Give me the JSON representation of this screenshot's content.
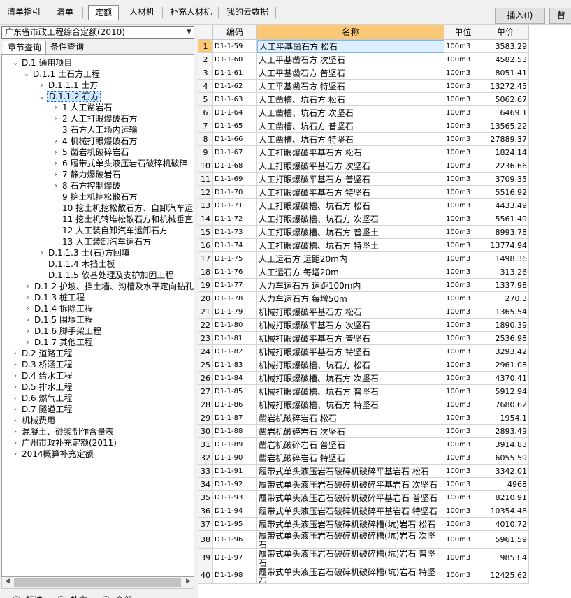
{
  "toolbar": {
    "tabs": [
      "清单指引",
      "清单",
      "定额",
      "人材机",
      "补充人材机",
      "我的云数据"
    ],
    "insert_button": "插入(I)",
    "replace_button": "替"
  },
  "left": {
    "library": "广东省市政工程综合定额(2010)",
    "tabs": [
      "章节查询",
      "条件查询"
    ],
    "tree": [
      "D.1 通用项目",
      "D.1.1 土石方工程",
      "D.1.1.1 土方",
      "D.1.1.2 石方",
      "1 人工凿岩石",
      "2 人工打眼爆破石方",
      "3 石方人工场内运输",
      "4 机械打眼爆破石方",
      "5 凿岩机破碎岩石",
      "6 履带式单头液压岩石破碎机破碎",
      "7 静力爆破岩石",
      "8 石方控制爆破",
      "9 挖土机挖松散石方",
      "10 挖土机挖松散石方、自卸汽车运",
      "11 挖土机转堆松散石方和机械垂直",
      "12 人工装自卸汽车运卸石方",
      "13 人工装卸汽车运石方",
      "D.1.1.3 土(石)方回填",
      "D.1.1.4 木挡土板",
      "D.1.1.5 软基处理及支护加固工程",
      "D.1.2 护坡、挡土墙、沟槽及水平定向钻孔",
      "D.1.3 桩工程",
      "D.1.4  拆除工程",
      "D.1.5 围堰工程",
      "D.1.6 脚手架工程",
      "D.1.7 其他工程",
      "D.2 道路工程",
      "D.3 桥涵工程",
      "D.4 给水工程",
      "D.5 排水工程",
      "D.6 燃气工程",
      "D.7 隧道工程",
      "机械费用",
      "混凝土、砂浆制作含量表",
      "广州市政补充定额(2011)",
      "2014概算补充定额"
    ],
    "radios": [
      "标准",
      "补充",
      "全部"
    ]
  },
  "table": {
    "headers": [
      "编码",
      "名称",
      "单位",
      "单价"
    ],
    "rows": [
      [
        "1",
        "D1-1-59",
        "人工平基凿石方 松石",
        "100m3",
        "3583.29"
      ],
      [
        "2",
        "D1-1-60",
        "人工平基凿石方 次坚石",
        "100m3",
        "4582.53"
      ],
      [
        "3",
        "D1-1-61",
        "人工平基凿石方 普坚石",
        "100m3",
        "8051.41"
      ],
      [
        "4",
        "D1-1-62",
        "人工平基凿石方 特坚石",
        "100m3",
        "13272.45"
      ],
      [
        "5",
        "D1-1-63",
        "人工凿槽、坑石方 松石",
        "100m3",
        "5062.67"
      ],
      [
        "6",
        "D1-1-64",
        "人工凿槽、坑石方 次坚石",
        "100m3",
        "6469.1"
      ],
      [
        "7",
        "D1-1-65",
        "人工凿槽、坑石方 普坚石",
        "100m3",
        "13565.22"
      ],
      [
        "8",
        "D1-1-66",
        "人工凿槽、坑石方 特坚石",
        "100m3",
        "27889.37"
      ],
      [
        "9",
        "D1-1-67",
        "人工打眼爆破平基石方 松石",
        "100m3",
        "1824.14"
      ],
      [
        "10",
        "D1-1-68",
        "人工打眼爆破平基石方 次坚石",
        "100m3",
        "2236.66"
      ],
      [
        "11",
        "D1-1-69",
        "人工打眼爆破平基石方 普坚石",
        "100m3",
        "3709.35"
      ],
      [
        "12",
        "D1-1-70",
        "人工打眼爆破平基石方 特坚石",
        "100m3",
        "5516.92"
      ],
      [
        "13",
        "D1-1-71",
        "人工打眼爆破槽、坑石方 松石",
        "100m3",
        "4433.49"
      ],
      [
        "14",
        "D1-1-72",
        "人工打眼爆破槽、坑石方 次坚石",
        "100m3",
        "5561.49"
      ],
      [
        "15",
        "D1-1-73",
        "人工打眼爆破槽、坑石方 普坚土",
        "100m3",
        "8993.78"
      ],
      [
        "16",
        "D1-1-74",
        "人工打眼爆破槽、坑石方 特坚土",
        "100m3",
        "13774.94"
      ],
      [
        "17",
        "D1-1-75",
        "人工运石方 运距20m内",
        "100m3",
        "1498.36"
      ],
      [
        "18",
        "D1-1-76",
        "人工运石方 每增20m",
        "100m3",
        "313.26"
      ],
      [
        "19",
        "D1-1-77",
        "人力车运石方 运距100m内",
        "100m3",
        "1337.98"
      ],
      [
        "20",
        "D1-1-78",
        "人力车运石方 每增50m",
        "100m3",
        "270.3"
      ],
      [
        "21",
        "D1-1-79",
        "机械打眼爆破平基石方 松石",
        "100m3",
        "1365.54"
      ],
      [
        "22",
        "D1-1-80",
        "机械打眼爆破平基石方 次坚石",
        "100m3",
        "1890.39"
      ],
      [
        "23",
        "D1-1-81",
        "机械打眼爆破平基石方 普坚石",
        "100m3",
        "2536.98"
      ],
      [
        "24",
        "D1-1-82",
        "机械打眼爆破平基石方 特坚石",
        "100m3",
        "3293.42"
      ],
      [
        "25",
        "D1-1-83",
        "机械打眼爆破槽、坑石方 松石",
        "100m3",
        "2961.08"
      ],
      [
        "26",
        "D1-1-84",
        "机械打眼爆破槽、坑石方 次坚石",
        "100m3",
        "4370.41"
      ],
      [
        "27",
        "D1-1-85",
        "机械打眼爆破槽、坑石方 普坚石",
        "100m3",
        "5912.94"
      ],
      [
        "28",
        "D1-1-86",
        "机械打眼爆破槽、坑石方 特坚石",
        "100m3",
        "7680.62"
      ],
      [
        "29",
        "D1-1-87",
        "凿岩机破碎岩石 松石",
        "100m3",
        "1954.1"
      ],
      [
        "30",
        "D1-1-88",
        "凿岩机破碎岩石 次坚石",
        "100m3",
        "2893.49"
      ],
      [
        "31",
        "D1-1-89",
        "凿岩机破碎岩石 普坚石",
        "100m3",
        "3914.83"
      ],
      [
        "32",
        "D1-1-90",
        "凿岩机破碎岩石 特坚石",
        "100m3",
        "6055.59"
      ],
      [
        "33",
        "D1-1-91",
        "履带式单头液压岩石破碎机破碎平基岩石 松石",
        "100m3",
        "3342.01"
      ],
      [
        "34",
        "D1-1-92",
        "履带式单头液压岩石破碎机破碎平基岩石 次坚石",
        "100m3",
        "4968"
      ],
      [
        "35",
        "D1-1-93",
        "履带式单头液压岩石破碎机破碎平基岩石 普坚石",
        "100m3",
        "8210.91"
      ],
      [
        "36",
        "D1-1-94",
        "履带式单头液压岩石破碎机破碎平基岩石 特坚石",
        "100m3",
        "10354.48"
      ],
      [
        "37",
        "D1-1-95",
        "履带式单头液压岩石破碎机破碎槽(坑)岩石 松石",
        "100m3",
        "4010.72"
      ],
      [
        "38",
        "D1-1-96",
        "履带式单头液压岩石破碎机破碎槽(坑)岩石 次坚石",
        "100m3",
        "5961.59"
      ],
      [
        "39",
        "D1-1-97",
        "履带式单头液压岩石破碎机破碎槽(坑)岩石 普坚石",
        "100m3",
        "9853.4"
      ],
      [
        "40",
        "D1-1-98",
        "履带式单头液压岩石破碎机破碎槽(坑)岩石 特坚石",
        "100m3",
        "12425.62"
      ]
    ]
  }
}
